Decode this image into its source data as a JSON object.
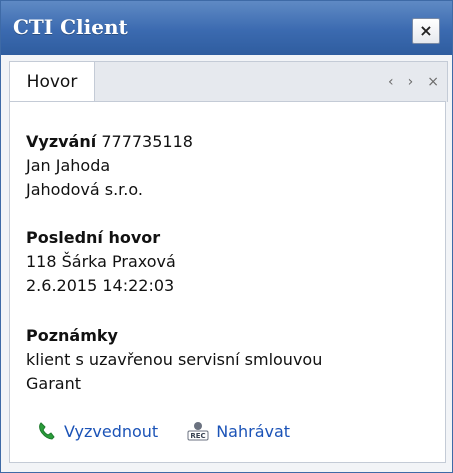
{
  "window": {
    "title": "CTI Client",
    "close_symbol": "×"
  },
  "tabs": [
    {
      "label": "Hovor"
    }
  ],
  "tab_controls": {
    "left": "‹",
    "right": "›",
    "close": "×"
  },
  "call": {
    "label": "Vyzvání",
    "number": "777735118",
    "name": "Jan Jahoda",
    "company": "Jahodová s.r.o."
  },
  "last_call": {
    "heading": "Poslední hovor",
    "caller": "118 Šárka Praxová",
    "datetime": "2.6.2015 14:22:03"
  },
  "notes": {
    "heading": "Poznámky",
    "line1": "klient s uzavřenou servisní smlouvou",
    "line2": "Garant"
  },
  "actions": {
    "answer_label": "Vyzvednout",
    "record_label": "Nahrávat",
    "answer_icon": "phone-icon",
    "record_icon": "rec-icon"
  }
}
